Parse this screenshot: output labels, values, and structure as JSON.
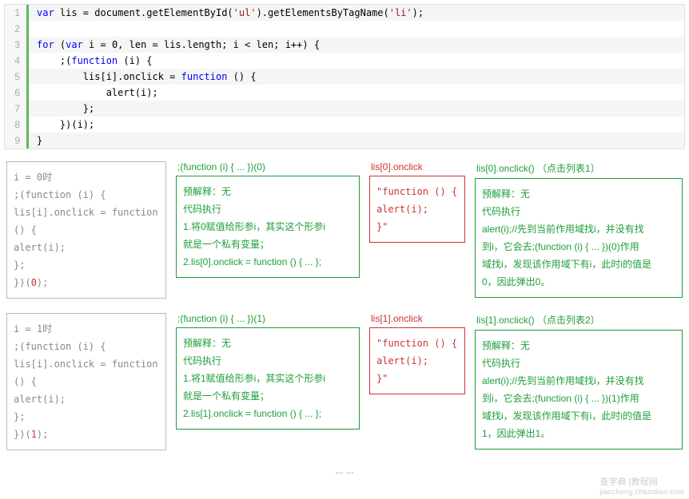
{
  "code": {
    "lines": [
      {
        "n": "1",
        "hl": true,
        "html": "<span class='kw-blue'>var</span> lis = document.getElementById(<span class='kw-str'>'ul'</span>).getElementsByTagName(<span class='kw-str'>'li'</span>);"
      },
      {
        "n": "2",
        "hl": false,
        "html": ""
      },
      {
        "n": "3",
        "hl": true,
        "html": "<span class='kw-blue'>for</span> (<span class='kw-blue'>var</span> i = 0, len = lis.length; i &lt; len; i++) {"
      },
      {
        "n": "4",
        "hl": false,
        "html": "    ;(<span class='kw-blue'>function</span> (i) {"
      },
      {
        "n": "5",
        "hl": true,
        "html": "        lis[i].onclick = <span class='kw-blue'>function</span> () {"
      },
      {
        "n": "6",
        "hl": false,
        "html": "            alert(i);"
      },
      {
        "n": "7",
        "hl": true,
        "html": "        };"
      },
      {
        "n": "8",
        "hl": false,
        "html": "    })(i);"
      },
      {
        "n": "9",
        "hl": true,
        "html": "}"
      }
    ]
  },
  "rows": [
    {
      "col1": {
        "l1": "i = 0时",
        "l2": ";(function (i) {",
        "l3": "  lis[i].onclick = function () {",
        "l4": "    alert(i);",
        "l5": "  };",
        "l6_pre": "})(",
        "l6_hi": "0",
        "l6_post": ");"
      },
      "col2": {
        "hdr": ";(function (i) { ... })(0)",
        "l1": "预解释：无",
        "l2": "代码执行",
        "l3": "1.将0赋值给形参i，其实这个形参i",
        "l4": "就是一个私有变量；",
        "l5": "2.lis[0].onclick = function () { ... };"
      },
      "col3": {
        "hdr": "lis[0].onclick",
        "l1": "\"function () {",
        "l2": "   alert(i);",
        "l3": "}\""
      },
      "col4": {
        "hdr": "lis[0].onclick() （点击列表1）",
        "l1": "预解释：无",
        "l2": "代码执行",
        "l3": "alert(i);//先到当前作用域找i，并没有找",
        "l4": "到i，它会去;(function (i) { ... })(0)作用",
        "l5": "域找i，发现该作用域下有i，此时i的值是",
        "l6": "0，因此弹出0。"
      }
    },
    {
      "col1": {
        "l1": "i = 1时",
        "l2": ";(function (i) {",
        "l3": "  lis[i].onclick = function () {",
        "l4": "    alert(i);",
        "l5": "  };",
        "l6_pre": "})(",
        "l6_hi": "1",
        "l6_post": ");"
      },
      "col2": {
        "hdr": ";(function (i) { ... })(1)",
        "l1": "预解释：无",
        "l2": "代码执行",
        "l3": "1.将1赋值给形参i，其实这个形参i",
        "l4": "就是一个私有变量；",
        "l5": "2.lis[1].onclick = function () { ... };"
      },
      "col3": {
        "hdr": "lis[1].onclick",
        "l1": "\"function () {",
        "l2": "   alert(i);",
        "l3": "}\""
      },
      "col4": {
        "hdr": "lis[1].onclick() （点击列表2）",
        "l1": "预解释：无",
        "l2": "代码执行",
        "l3": "alert(i);//先到当前作用域找i，并没有找",
        "l4": "到i，它会去;(function (i) { ... })(1)作用",
        "l5": "域找i，发现该作用域下有i，此时i的值是",
        "l6": "1，因此弹出1。"
      }
    }
  ],
  "ellipsis": "... ...",
  "watermark": {
    "main": "查字典 [教程网",
    "url": "jiaocheng.chazidian.com"
  }
}
